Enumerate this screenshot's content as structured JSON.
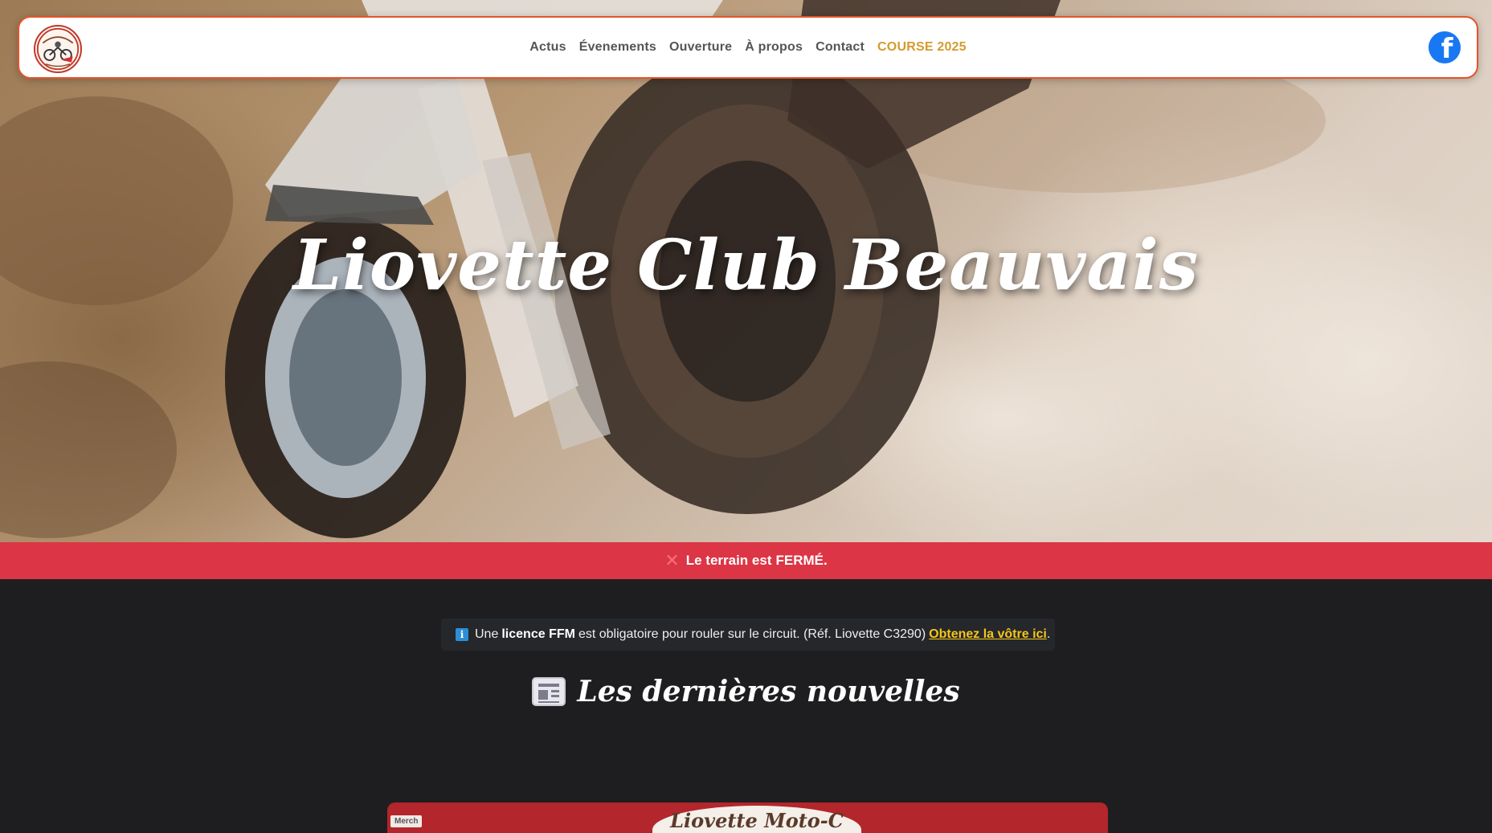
{
  "navbar": {
    "logo_icon": "club-logo",
    "links": [
      {
        "label": "Actus"
      },
      {
        "label": "Évenements"
      },
      {
        "label": "Ouverture"
      },
      {
        "label": "À propos"
      },
      {
        "label": "Contact"
      },
      {
        "label": "COURSE 2025"
      }
    ],
    "social_icon": "facebook-icon",
    "social_glyph": "f"
  },
  "hero": {
    "title": "Liovette Club Beauvais"
  },
  "status": {
    "icon": "✕",
    "text": "Le terrain est",
    "state": "FERMÉ",
    "suffix": "."
  },
  "notice": {
    "icon": "i",
    "prefix": "Une",
    "strong": "licence FFM",
    "text": "est obligatoire pour rouler sur le circuit. (Réf. Liovette C3290)",
    "link": "Obtenez la vôtre ici",
    "suffix": "."
  },
  "news": {
    "heading": "Les dernières nouvelles"
  },
  "card": {
    "tag": "Merch",
    "image_text": "Liovette Moto-C"
  },
  "colors": {
    "navbar_border": "#e4552a",
    "course_link": "#d49b2e",
    "status_bg": "#dc3545",
    "page_bg": "#1e1e20",
    "link_accent": "#f5c518",
    "facebook": "#1877f2"
  }
}
